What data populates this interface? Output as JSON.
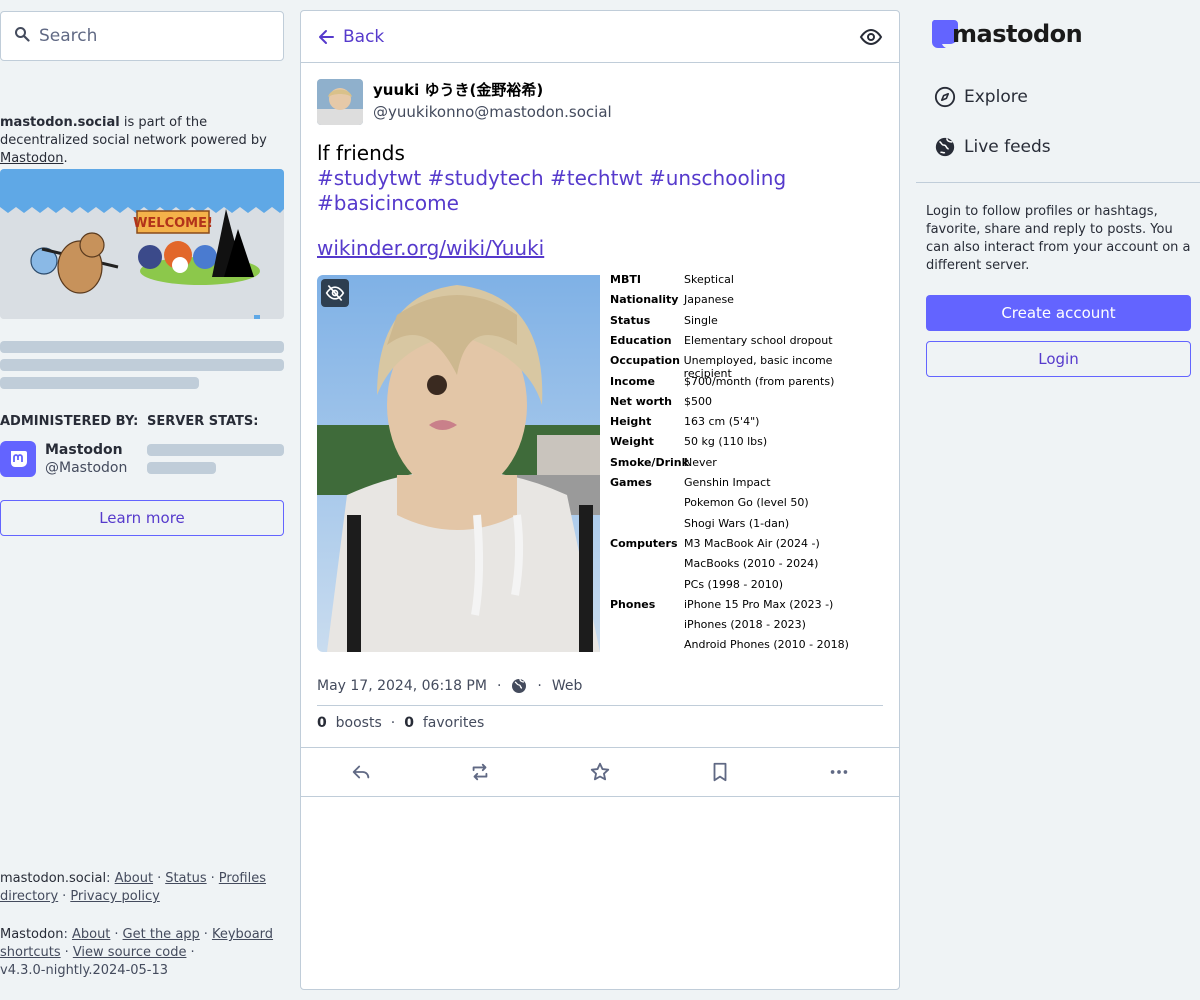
{
  "search": {
    "placeholder": "Search"
  },
  "server_about": {
    "domain": "mastodon.social",
    "text_before_link": " is part of the decentralized social network powered by ",
    "link_text": "Mastodon",
    "text_after_link": "."
  },
  "hero_image": {
    "banner_text": "WELCOME!"
  },
  "admin": {
    "label": "ADMINISTERED BY:",
    "name": "Mastodon",
    "acct": "@Mastodon"
  },
  "server_stats": {
    "label": "SERVER STATS:"
  },
  "learn_more_label": "Learn more",
  "footer": {
    "server": {
      "name": "mastodon.social",
      "links": [
        "About",
        "Status",
        "Profiles directory",
        "Privacy policy"
      ]
    },
    "app": {
      "name": "Mastodon",
      "links": [
        "About",
        "Get the app",
        "Keyboard shortcuts",
        "View source code"
      ],
      "version": "v4.3.0-nightly.2024-05-13"
    }
  },
  "column_header": {
    "back_label": "Back"
  },
  "status": {
    "display_name": "yuuki ゆうき(金野裕希)",
    "acct": "@yuukikonno@mastodon.social",
    "text": "lf friends",
    "hashtags": "#studytwt #studytech #techtwt #unschooling #basicincome",
    "link": "wikinder.org/wiki/Yuuki",
    "profile_card": [
      {
        "key": "MBTI",
        "value": "Skeptical"
      },
      {
        "key": "Nationality",
        "value": "Japanese"
      },
      {
        "key": "Status",
        "value": "Single"
      },
      {
        "key": "Education",
        "value": "Elementary school dropout"
      },
      {
        "key": "Occupation",
        "value": "Unemployed, basic income recipient"
      },
      {
        "key": "Income",
        "value": "$700/month (from parents)"
      },
      {
        "key": "Net worth",
        "value": "$500"
      },
      {
        "key": "Height",
        "value": "163 cm (5'4\")"
      },
      {
        "key": "Weight",
        "value": "50 kg (110 lbs)"
      },
      {
        "key": "Smoke/Drink",
        "value": "Never"
      },
      {
        "key": "Games",
        "value": "Genshin Impact"
      },
      {
        "key": "",
        "value": "Pokemon Go (level 50)"
      },
      {
        "key": "",
        "value": "Shogi Wars (1-dan)"
      },
      {
        "key": "Computers",
        "value": "M3 MacBook Air (2024 -)"
      },
      {
        "key": "",
        "value": "MacBooks (2010 - 2024)"
      },
      {
        "key": "",
        "value": "PCs (1998 - 2010)"
      },
      {
        "key": "Phones",
        "value": "iPhone 15 Pro Max (2023 -)"
      },
      {
        "key": "",
        "value": "iPhones (2018 - 2023)"
      },
      {
        "key": "",
        "value": "Android Phones (2010 - 2018)"
      }
    ],
    "timestamp": "May 17, 2024, 06:18 PM",
    "visibility_icon": "globe-icon",
    "application": "Web",
    "boosts_count": "0",
    "boosts_label": "boosts",
    "favorites_count": "0",
    "favorites_label": "favorites"
  },
  "actions": [
    "reply-icon",
    "boost-icon",
    "favorite-icon",
    "bookmark-icon",
    "more-icon"
  ],
  "right_nav": {
    "logo_text": "mastodon",
    "items": [
      {
        "label": "Explore",
        "icon": "compass-icon"
      },
      {
        "label": "Live feeds",
        "icon": "globe-icon"
      }
    ],
    "signup_text": "Login to follow profiles or hashtags, favorite, share and reply to posts. You can also interact from your account on a different server.",
    "create_account_label": "Create account",
    "login_label": "Login"
  },
  "colors": {
    "accent": "#6364ff",
    "link": "#563acc",
    "background": "#eff3f5",
    "border": "#c0cdd9"
  }
}
